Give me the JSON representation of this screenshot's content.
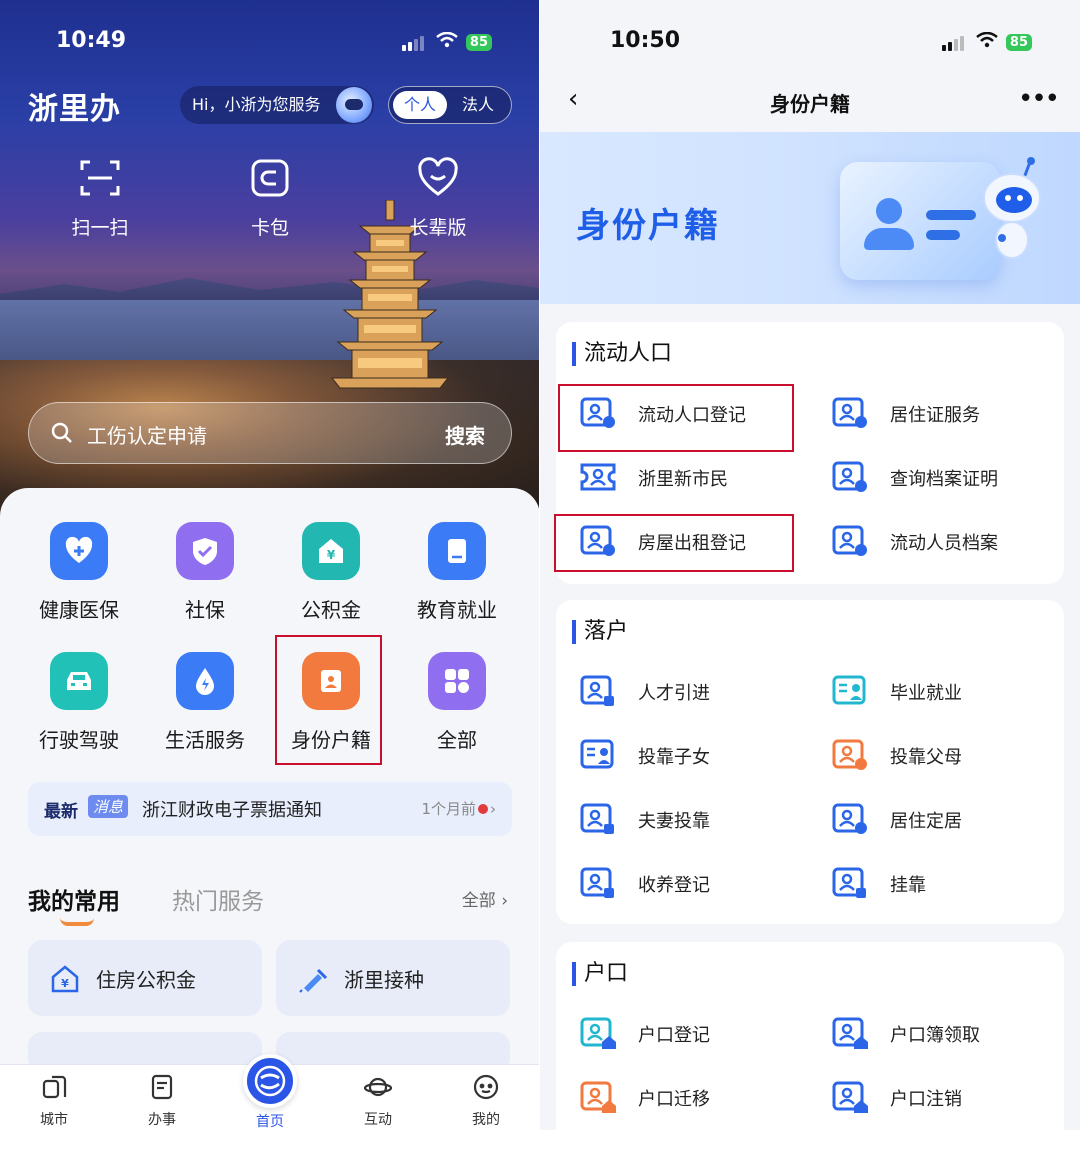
{
  "left": {
    "status": {
      "time": "10:49",
      "battery": "85"
    },
    "app_name": "浙里办",
    "greeting": "Hi，小浙为您服务",
    "roles": [
      "个人",
      "法人"
    ],
    "quick_actions": [
      {
        "label": "扫一扫",
        "icon": "scan-icon"
      },
      {
        "label": "卡包",
        "icon": "card-wallet-icon"
      },
      {
        "label": "长辈版",
        "icon": "heart-icon"
      }
    ],
    "search": {
      "placeholder": "工伤认定申请",
      "button": "搜索"
    },
    "services": [
      {
        "label": "健康医保",
        "icon": "health-insurance-icon",
        "color": "#3b7bf6"
      },
      {
        "label": "社保",
        "icon": "social-security-icon",
        "color": "#8f6ff0"
      },
      {
        "label": "公积金",
        "icon": "housing-fund-icon",
        "color": "#22b7b0"
      },
      {
        "label": "教育就业",
        "icon": "education-icon",
        "color": "#3b7bf6"
      },
      {
        "label": "行驶驾驶",
        "icon": "car-icon",
        "color": "#22c1b8"
      },
      {
        "label": "生活服务",
        "icon": "water-drop-icon",
        "color": "#3b7bf6"
      },
      {
        "label": "身份户籍",
        "icon": "id-card-icon",
        "color": "#f27a3f"
      },
      {
        "label": "全部",
        "icon": "grid-icon",
        "color": "#8f6ff0"
      }
    ],
    "news": {
      "tag_a": "最新",
      "tag_b": "消息",
      "text": "浙江财政电子票据通知",
      "time": "1个月前"
    },
    "tabs": {
      "active": "我的常用",
      "other": "热门服务",
      "all": "全部 ›"
    },
    "favorites": [
      {
        "label": "住房公积金",
        "icon": "house-fund-icon"
      },
      {
        "label": "浙里接种",
        "icon": "syringe-icon"
      }
    ],
    "tabbar": [
      "城市",
      "办事",
      "首页",
      "互动",
      "我的"
    ]
  },
  "right": {
    "status": {
      "time": "10:50",
      "battery": "85"
    },
    "title": "身份户籍",
    "banner_title": "身份户籍",
    "sections": [
      {
        "title": "流动人口",
        "items": [
          {
            "label": "流动人口登记",
            "icon": "person-card-swap-icon",
            "color": "#2b66e8"
          },
          {
            "label": "居住证服务",
            "icon": "person-card-doc-icon",
            "color": "#2b66e8"
          },
          {
            "label": "浙里新市民",
            "icon": "person-ticket-icon",
            "color": "#2b66e8"
          },
          {
            "label": "查询档案证明",
            "icon": "person-card-swap-icon",
            "color": "#2b66e8"
          },
          {
            "label": "房屋出租登记",
            "icon": "person-card-swap-icon",
            "color": "#2b66e8"
          },
          {
            "label": "流动人员档案",
            "icon": "person-card-swap-icon",
            "color": "#2b66e8"
          }
        ]
      },
      {
        "title": "落户",
        "items": [
          {
            "label": "人才引进",
            "icon": "person-card-stamp-icon",
            "color": "#2b66e8"
          },
          {
            "label": "毕业就业",
            "icon": "list-card-person-icon",
            "color": "#22b7d0"
          },
          {
            "label": "投靠子女",
            "icon": "list-card-person-icon",
            "color": "#2b66e8"
          },
          {
            "label": "投靠父母",
            "icon": "person-card-swap-icon",
            "color": "#f27a3f"
          },
          {
            "label": "夫妻投靠",
            "icon": "person-card-stamp-icon",
            "color": "#2b66e8"
          },
          {
            "label": "居住定居",
            "icon": "person-card-swap-icon",
            "color": "#2b66e8"
          },
          {
            "label": "收养登记",
            "icon": "person-card-stamp-icon",
            "color": "#2b66e8"
          },
          {
            "label": "挂靠",
            "icon": "person-card-stamp-icon",
            "color": "#2b66e8"
          }
        ]
      },
      {
        "title": "户口",
        "items": [
          {
            "label": "户口登记",
            "icon": "person-card-home-icon",
            "color": "#22b7d0"
          },
          {
            "label": "户口簿领取",
            "icon": "person-card-home-icon",
            "color": "#2b66e8"
          },
          {
            "label": "户口迁移",
            "icon": "person-card-home-icon",
            "color": "#f27a3f"
          },
          {
            "label": "户口注销",
            "icon": "person-card-home-icon",
            "color": "#2b66e8"
          }
        ]
      }
    ]
  }
}
